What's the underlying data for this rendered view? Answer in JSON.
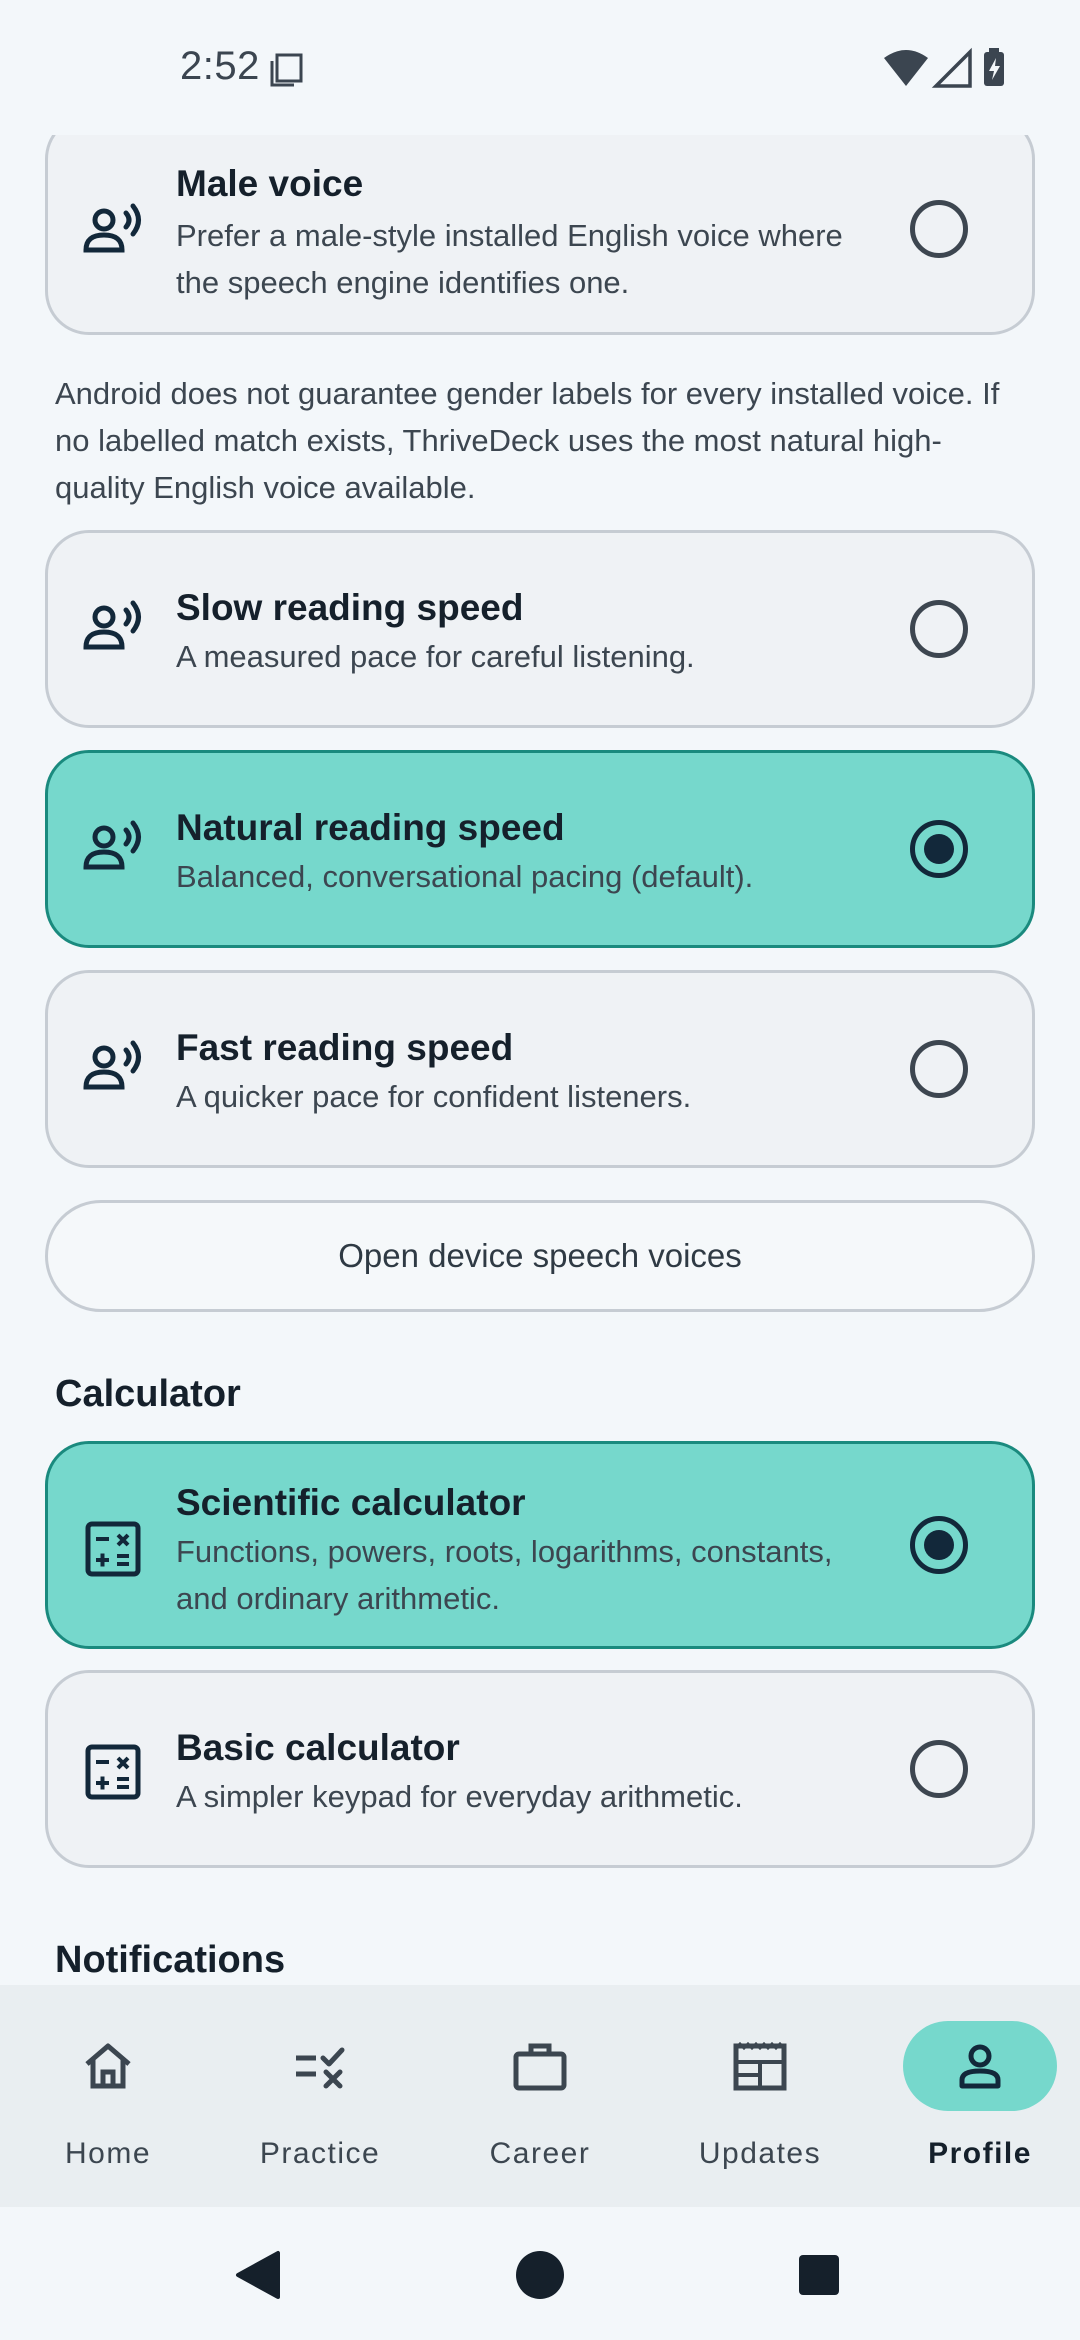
{
  "status": {
    "time": "2:52"
  },
  "voice_cards": [
    {
      "title": "Male voice",
      "subtitle": "Prefer a male-style installed English voice where the speech engine identifies one.",
      "selected": false
    },
    {
      "title": "Slow reading speed",
      "subtitle": "A measured pace for careful listening.",
      "selected": false
    },
    {
      "title": "Natural reading speed",
      "subtitle": "Balanced, conversational pacing (default).",
      "selected": true
    },
    {
      "title": "Fast reading speed",
      "subtitle": "A quicker pace for confident listeners.",
      "selected": false
    }
  ],
  "voice_note": "Android does not guarantee gender labels for every installed voice. If no labelled match exists, ThriveDeck uses the most natural high-quality English voice available.",
  "open_voices_label": "Open device speech voices",
  "calculator": {
    "heading": "Calculator",
    "options": [
      {
        "title": "Scientific calculator",
        "subtitle": "Functions, powers, roots, logarithms, constants, and ordinary arithmetic.",
        "selected": true
      },
      {
        "title": "Basic calculator",
        "subtitle": "A simpler keypad for everyday arithmetic.",
        "selected": false
      }
    ]
  },
  "notifications_heading": "Notifications",
  "bottom_nav": [
    {
      "label": "Home",
      "icon": "home-icon",
      "active": false
    },
    {
      "label": "Practice",
      "icon": "practice-icon",
      "active": false
    },
    {
      "label": "Career",
      "icon": "briefcase-icon",
      "active": false
    },
    {
      "label": "Updates",
      "icon": "newspaper-icon",
      "active": false
    },
    {
      "label": "Profile",
      "icon": "person-icon",
      "active": true
    }
  ],
  "colors": {
    "accent": "#76d8cc",
    "accent_border": "#1a8a7e",
    "ink": "#12283a",
    "background": "#f3f7fa"
  }
}
